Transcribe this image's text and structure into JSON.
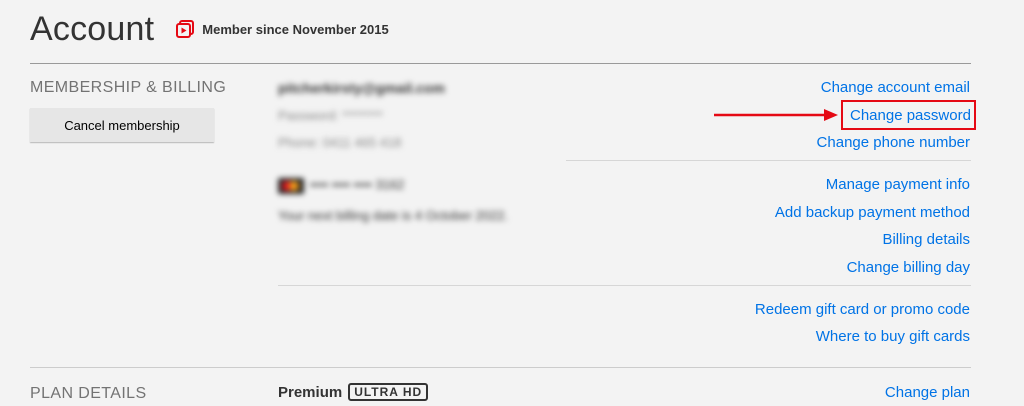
{
  "header": {
    "title": "Account",
    "member_since": "Member since November 2015",
    "icon": "member-badge-icon",
    "icon_color": "#e50914"
  },
  "membership": {
    "section_label": "MEMBERSHIP & BILLING",
    "cancel_label": "Cancel membership",
    "email_redacted": "pitcherkirsty@gmail.com",
    "password_redacted": "Password: ********",
    "phone_redacted": "Phone: 0411 465 418",
    "card_redacted": "•••• •••• •••• 3162",
    "billing_date_redacted": "Your next billing date is 4 October 2022.",
    "links": {
      "change_email": "Change account email",
      "change_password": "Change password",
      "change_phone": "Change phone number",
      "manage_payment": "Manage payment info",
      "add_backup": "Add backup payment method",
      "billing_details": "Billing details",
      "change_billing_day": "Change billing day",
      "redeem_gift": "Redeem gift card or promo code",
      "where_buy": "Where to buy gift cards"
    }
  },
  "plan": {
    "section_label": "PLAN DETAILS",
    "plan_name": "Premium",
    "plan_badge": "ULTRA HD",
    "change_plan": "Change plan"
  },
  "colors": {
    "link": "#0073e6",
    "highlight": "#e50914",
    "background": "#f3f3f3"
  }
}
